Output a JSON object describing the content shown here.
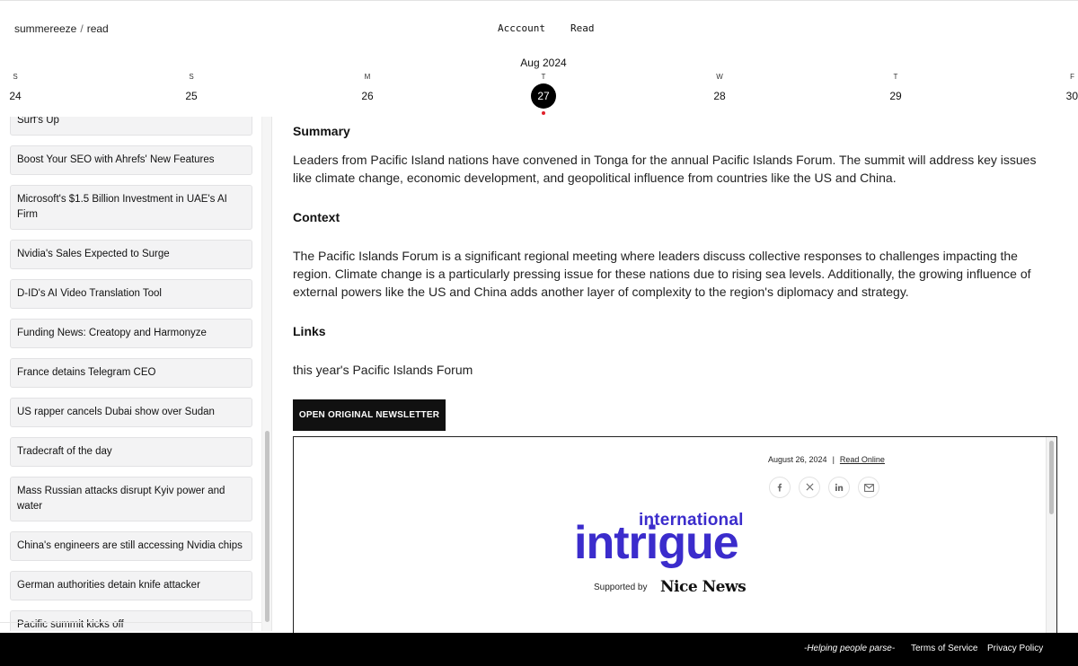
{
  "breadcrumb": {
    "user": "summereeze",
    "sep": "/",
    "page": "read"
  },
  "nav": {
    "account": "Acccount",
    "read": "Read"
  },
  "calendar": {
    "month": "Aug 2024",
    "days": [
      {
        "dow": "S",
        "num": "24"
      },
      {
        "dow": "S",
        "num": "25"
      },
      {
        "dow": "M",
        "num": "26"
      },
      {
        "dow": "T",
        "num": "27"
      },
      {
        "dow": "W",
        "num": "28"
      },
      {
        "dow": "T",
        "num": "29"
      },
      {
        "dow": "F",
        "num": "30"
      }
    ],
    "selected": "27"
  },
  "sidebar": {
    "items": [
      "Surf's Up",
      "Boost Your SEO with Ahrefs' New Features",
      "Microsoft's $1.5 Billion Investment in UAE's AI Firm",
      "Nvidia's Sales Expected to Surge",
      "D-ID's AI Video Translation Tool",
      "Funding News: Creatopy and Harmonyze",
      "France detains Telegram CEO",
      "US rapper cancels Dubai show over Sudan",
      "Tradecraft of the day",
      "Mass Russian attacks disrupt Kyiv power and water",
      "China's engineers are still accessing Nvidia chips",
      "German authorities detain knife attacker",
      "Pacific summit kicks off"
    ]
  },
  "article": {
    "summary_heading": "Summary",
    "summary_text": "Leaders from Pacific Island nations have convened in Tonga for the annual Pacific Islands Forum. The summit will address key issues like climate change, economic development, and geopolitical influence from countries like the US and China.",
    "context_heading": "Context",
    "context_text": "The Pacific Islands Forum is a significant regional meeting where leaders discuss collective responses to challenges impacting the region. Climate change is a particularly pressing issue for these nations due to rising sea levels. Additionally, the growing influence of external powers like the US and China adds another layer of complexity to the region's diplomacy and strategy.",
    "links_heading": "Links",
    "link_text": "this year's Pacific Islands Forum",
    "open_button": "OPEN ORIGINAL NEWSLETTER"
  },
  "newsletter": {
    "date": "August 26, 2024",
    "pipe": "|",
    "read_online": "Read Online",
    "logo_top": "international",
    "logo_main": "intrigue",
    "supported_by": "Supported by",
    "sponsor": "Nice News",
    "brand_color": "#3b2ccc",
    "social_icons": [
      "facebook-icon",
      "x-icon",
      "linkedin-icon",
      "email-icon"
    ]
  },
  "footer": {
    "tagline": "-Helping people parse-",
    "terms": "Terms of Service",
    "privacy": "Privacy Policy"
  }
}
